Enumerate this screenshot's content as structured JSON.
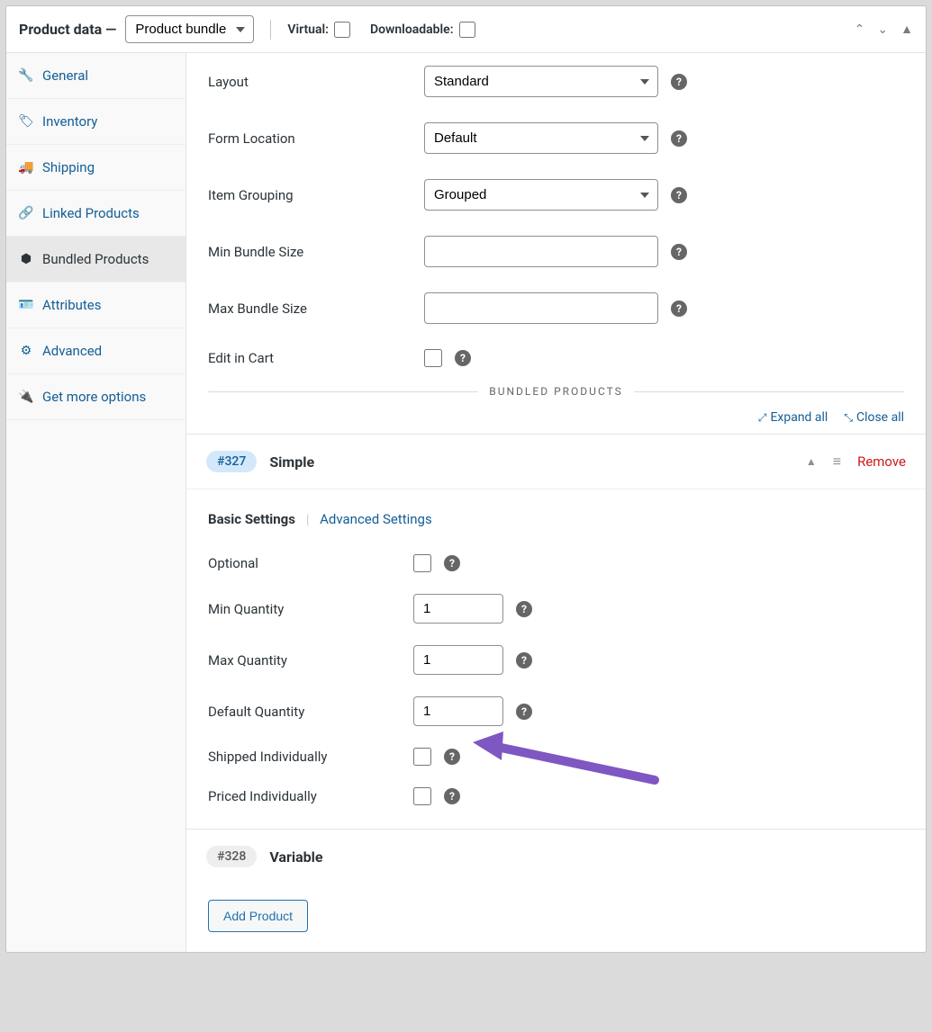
{
  "header": {
    "title": "Product data —",
    "product_type": "Product bundle",
    "virtual_label": "Virtual:",
    "downloadable_label": "Downloadable:"
  },
  "sidebar": {
    "items": [
      {
        "label": "General",
        "icon": "wrench"
      },
      {
        "label": "Inventory",
        "icon": "tag"
      },
      {
        "label": "Shipping",
        "icon": "truck"
      },
      {
        "label": "Linked Products",
        "icon": "link"
      },
      {
        "label": "Bundled Products",
        "icon": "hex"
      },
      {
        "label": "Attributes",
        "icon": "id"
      },
      {
        "label": "Advanced",
        "icon": "gear"
      },
      {
        "label": "Get more options",
        "icon": "plug"
      }
    ]
  },
  "form": {
    "layout_label": "Layout",
    "layout_value": "Standard",
    "form_location_label": "Form Location",
    "form_location_value": "Default",
    "item_grouping_label": "Item Grouping",
    "item_grouping_value": "Grouped",
    "min_bundle_label": "Min Bundle Size",
    "max_bundle_label": "Max Bundle Size",
    "edit_in_cart_label": "Edit in Cart"
  },
  "section": {
    "title": "BUNDLED PRODUCTS",
    "expand_all": "Expand all",
    "close_all": "Close all"
  },
  "bundle_items": [
    {
      "badge": "#327",
      "title": "Simple",
      "expanded": true,
      "tabs": {
        "basic": "Basic Settings",
        "advanced": "Advanced Settings"
      },
      "fields": {
        "optional_label": "Optional",
        "min_qty_label": "Min Quantity",
        "min_qty_value": "1",
        "max_qty_label": "Max Quantity",
        "max_qty_value": "1",
        "default_qty_label": "Default Quantity",
        "default_qty_value": "1",
        "shipped_label": "Shipped Individually",
        "priced_label": "Priced Individually"
      },
      "remove_label": "Remove"
    },
    {
      "badge": "#328",
      "title": "Variable",
      "expanded": false
    }
  ],
  "buttons": {
    "add_product": "Add Product"
  }
}
